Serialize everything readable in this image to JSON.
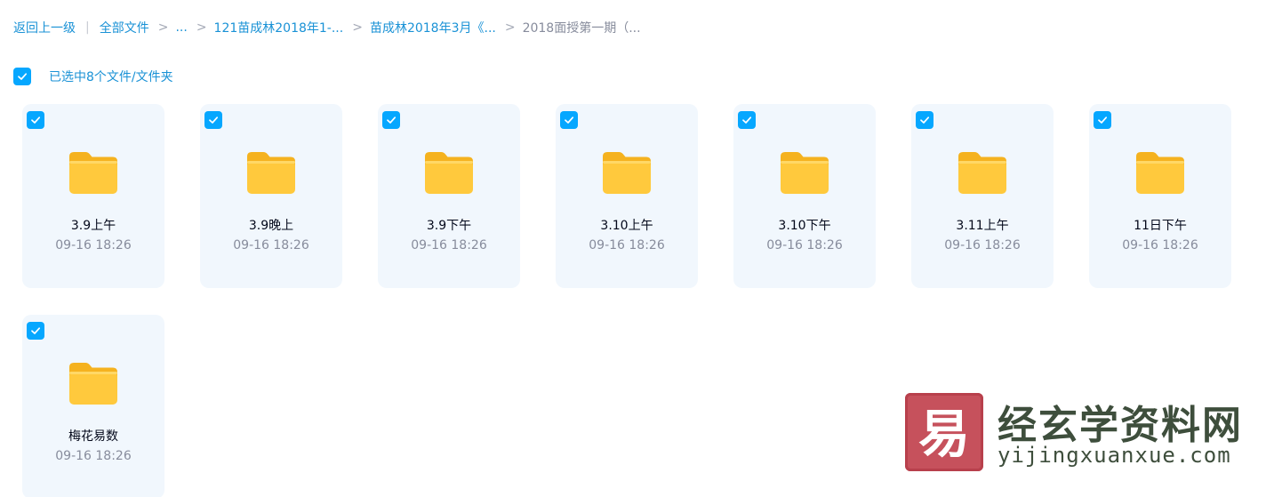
{
  "breadcrumb": {
    "back": "返回上一级",
    "root": "全部文件",
    "ellipsis": "...",
    "path1": "121苗成林2018年1-...",
    "path2": "苗成林2018年3月《...",
    "current": "2018面授第一期（...",
    "separator": ">",
    "pipe": "|"
  },
  "selection": {
    "label": "已选中8个文件/文件夹",
    "checked": true
  },
  "files": [
    {
      "name": "3.9上午",
      "time": "09-16 18:26",
      "checked": true
    },
    {
      "name": "3.9晚上",
      "time": "09-16 18:26",
      "checked": true
    },
    {
      "name": "3.9下午",
      "time": "09-16 18:26",
      "checked": true
    },
    {
      "name": "3.10上午",
      "time": "09-16 18:26",
      "checked": true
    },
    {
      "name": "3.10下午",
      "time": "09-16 18:26",
      "checked": true
    },
    {
      "name": "3.11上午",
      "time": "09-16 18:26",
      "checked": true
    },
    {
      "name": "11日下午",
      "time": "09-16 18:26",
      "checked": true
    },
    {
      "name": "梅花易数",
      "time": "09-16 18:26",
      "checked": true
    }
  ],
  "watermark": {
    "title": "经玄学资料网",
    "url": "yijingxuanxue.com",
    "seal_text": "易"
  },
  "icons": {
    "checkbox": "check-icon",
    "folder": "folder-icon"
  },
  "colors": {
    "accent": "#06a7ff",
    "link": "#1a92d6",
    "muted": "#878c9c",
    "card_bg": "#f1f7fd",
    "folder_yellow": "#ffc93d",
    "seal_red": "#c6515c"
  }
}
